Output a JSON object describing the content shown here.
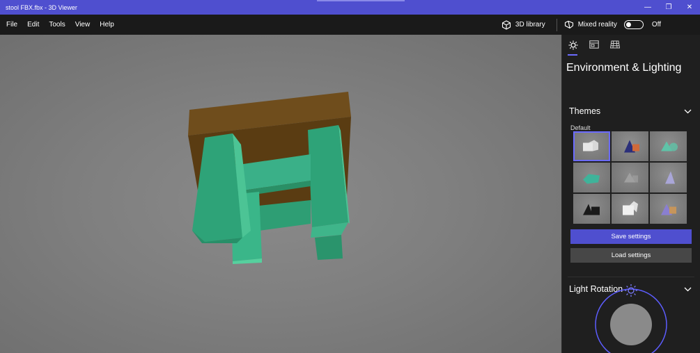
{
  "window": {
    "title": "stool FBX.fbx - 3D Viewer",
    "minimize_glyph": "—",
    "restore_glyph": "❐",
    "close_glyph": "✕"
  },
  "menu": {
    "items": [
      "File",
      "Edit",
      "Tools",
      "View",
      "Help"
    ],
    "library_label": "3D library",
    "mixed_reality_label": "Mixed reality",
    "mixed_reality_state": "Off"
  },
  "panel": {
    "title": "Environment & Lighting",
    "themes": {
      "heading": "Themes",
      "default_label": "Default",
      "selected_index": 0,
      "thumbnails": [
        {
          "bg": "#8c8c8c",
          "fg": "#e6e6e6"
        },
        {
          "bg": "#8f8f8f",
          "fg": "#d06a3a"
        },
        {
          "bg": "#8d8d8d",
          "fg": "#5fc3a8"
        },
        {
          "bg": "#8a8a8a",
          "fg": "#3fb39a"
        },
        {
          "bg": "#8b8b8b",
          "fg": "#a0a0a0"
        },
        {
          "bg": "#8e8e8e",
          "fg": "#a9a6d8"
        },
        {
          "bg": "#8c8c8c",
          "fg": "#1a1a1a"
        },
        {
          "bg": "#909090",
          "fg": "#f0f0f0"
        },
        {
          "bg": "#8d8d8d",
          "fg": "#c6955b"
        }
      ]
    },
    "save_label": "Save settings",
    "load_label": "Load settings",
    "light_rotation": {
      "heading": "Light Rotation"
    }
  },
  "colors": {
    "accent": "#4f4fcf",
    "wood": "#6a4818",
    "stool_green": "#2ea378"
  }
}
